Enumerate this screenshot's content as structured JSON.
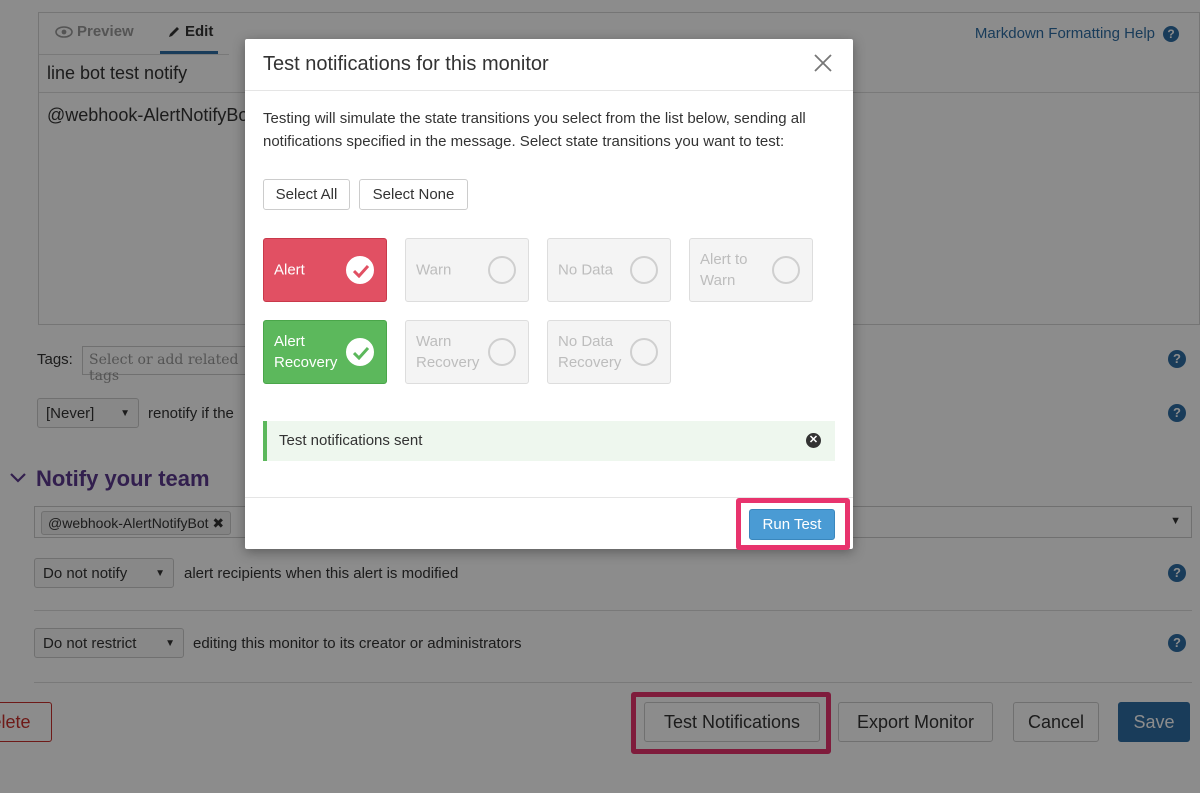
{
  "editor": {
    "tab_preview": "Preview",
    "tab_edit": "Edit",
    "markdown_help": "Markdown Formatting Help",
    "title_value": "line bot test notify",
    "body_value": "@webhook-AlertNotifyBot"
  },
  "tags": {
    "label": "Tags:",
    "placeholder": "Select or add related tags"
  },
  "renotify": {
    "select_value": "[Never]",
    "text": "renotify if the"
  },
  "notify_team": {
    "title": "Notify your team",
    "recipient": "@webhook-AlertNotifyBot"
  },
  "modify_notify": {
    "select_value": "Do not notify",
    "text": "alert recipients when this alert is modified"
  },
  "restrict": {
    "select_value": "Do not restrict",
    "text": "editing this monitor to its creator or administrators"
  },
  "footer": {
    "delete_label": "elete",
    "test_notifications_label": "Test Notifications",
    "export_label": "Export Monitor",
    "cancel_label": "Cancel",
    "save_label": "Save"
  },
  "modal": {
    "title": "Test notifications for this monitor",
    "description": "Testing will simulate the state transitions you select from the list below, sending all notifications specified in the message. Select state transitions you want to test:",
    "select_all": "Select All",
    "select_none": "Select None",
    "states": [
      {
        "label": "Alert",
        "checked": true,
        "color": "#e15063"
      },
      {
        "label": "Warn",
        "checked": false
      },
      {
        "label": "No Data",
        "checked": false
      },
      {
        "label": "Alert to Warn",
        "checked": false
      },
      {
        "label": "Alert Recovery",
        "checked": true,
        "color": "#5cb85c"
      },
      {
        "label": "Warn Recovery",
        "checked": false
      },
      {
        "label": "No Data Recovery",
        "checked": false
      }
    ],
    "status_message": "Test notifications sent",
    "run_test": "Run Test"
  },
  "colors": {
    "accent": "#2e6da4",
    "highlight": "#e8336d",
    "section_title": "#5b3a8e"
  },
  "icons": {
    "preview": "eye-icon",
    "edit": "pencil-icon",
    "help": "question-circle-icon",
    "close": "close-icon",
    "check": "check-circle-icon",
    "dismiss": "x-circle-icon",
    "collapse": "chevron-down-icon",
    "dropdown": "caret-down-icon"
  }
}
